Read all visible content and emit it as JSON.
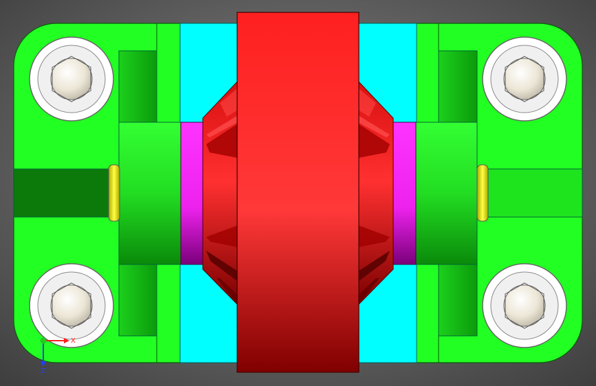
{
  "viewport": {
    "background_gradient": [
      "#8a8a8a",
      "#3d3d3d"
    ]
  },
  "colors": {
    "plate": "#22ff22",
    "plate_edge": "#0a5a0a",
    "boss_light": "#44ee44",
    "boss_dark": "#0a8a0a",
    "shaft_dark": "#0b7a0b",
    "channel": "#00ffff",
    "wheel": "#ff2a2a",
    "wheel_dark": "#7a0000",
    "ring": "#ff22ff",
    "ring_dark": "#7a007a",
    "washer": "#ffff33",
    "bolt_rim": "#ffffff",
    "bolt_head": "#f5f0e0"
  },
  "triad": {
    "x_label": "X",
    "z_label": "Z",
    "x_color": "#ff2020",
    "z_color": "#2040ff",
    "origin_color": "#20cc20"
  }
}
